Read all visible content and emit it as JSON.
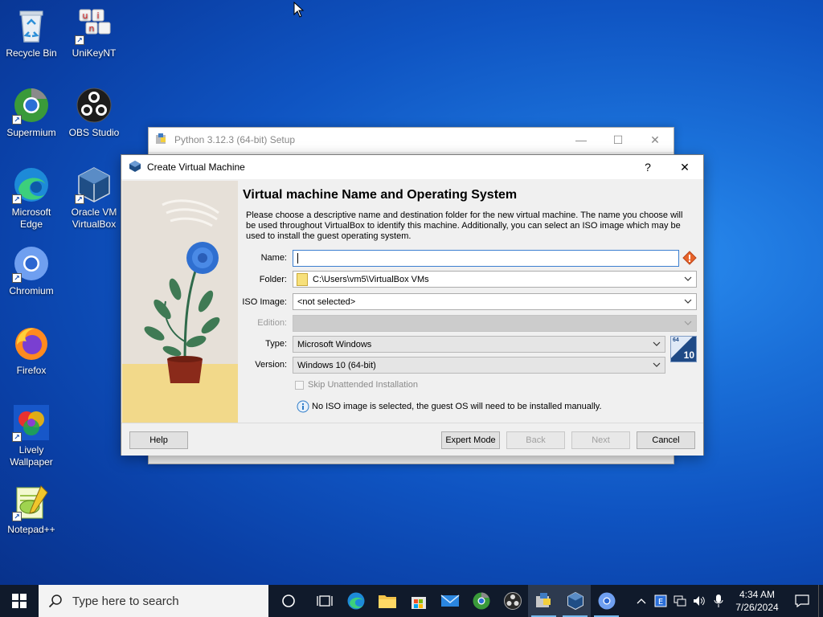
{
  "desktop": {
    "icons": [
      {
        "label": "Recycle Bin"
      },
      {
        "label": "UniKeyNT"
      },
      {
        "label": "Supermium"
      },
      {
        "label": "OBS Studio"
      },
      {
        "label": "Microsoft Edge"
      },
      {
        "label": "Oracle VM VirtualBox"
      },
      {
        "label": "Chromium"
      },
      {
        "label": "Firefox"
      },
      {
        "label": "Lively Wallpaper"
      },
      {
        "label": "Notepad++"
      }
    ]
  },
  "background_window": {
    "title": "Python 3.12.3 (64-bit) Setup"
  },
  "dialog": {
    "title": "Create Virtual Machine",
    "help_glyph": "?",
    "close_glyph": "✕",
    "heading": "Virtual machine Name and Operating System",
    "description": "Please choose a descriptive name and destination folder for the new virtual machine. The name you choose will be used throughout VirtualBox to identify this machine. Additionally, you can select an ISO image which may be used to install the guest operating system.",
    "fields": {
      "name_label": "Name:",
      "name_value": "",
      "folder_label": "Folder:",
      "folder_value": "C:\\Users\\vm5\\VirtualBox VMs",
      "iso_label": "ISO Image:",
      "iso_value": "<not selected>",
      "edition_label": "Edition:",
      "edition_value": "",
      "type_label": "Type:",
      "type_value": "Microsoft Windows",
      "version_label": "Version:",
      "version_value": "Windows 10 (64-bit)",
      "os_badge": "10",
      "os_badge_bits": "64"
    },
    "skip_unattended_label": "Skip Unattended Installation",
    "skip_unattended_checked": false,
    "info_message": "No ISO image is selected, the guest OS will need to be installed manually.",
    "buttons": {
      "help": "Help",
      "expert": "Expert Mode",
      "back": "Back",
      "next": "Next",
      "cancel": "Cancel"
    }
  },
  "taskbar": {
    "search_placeholder": "Type here to search",
    "time": "4:34 AM",
    "date": "7/26/2024",
    "colors": {
      "background": "#101a2b",
      "accent": "#76b9ed"
    }
  }
}
